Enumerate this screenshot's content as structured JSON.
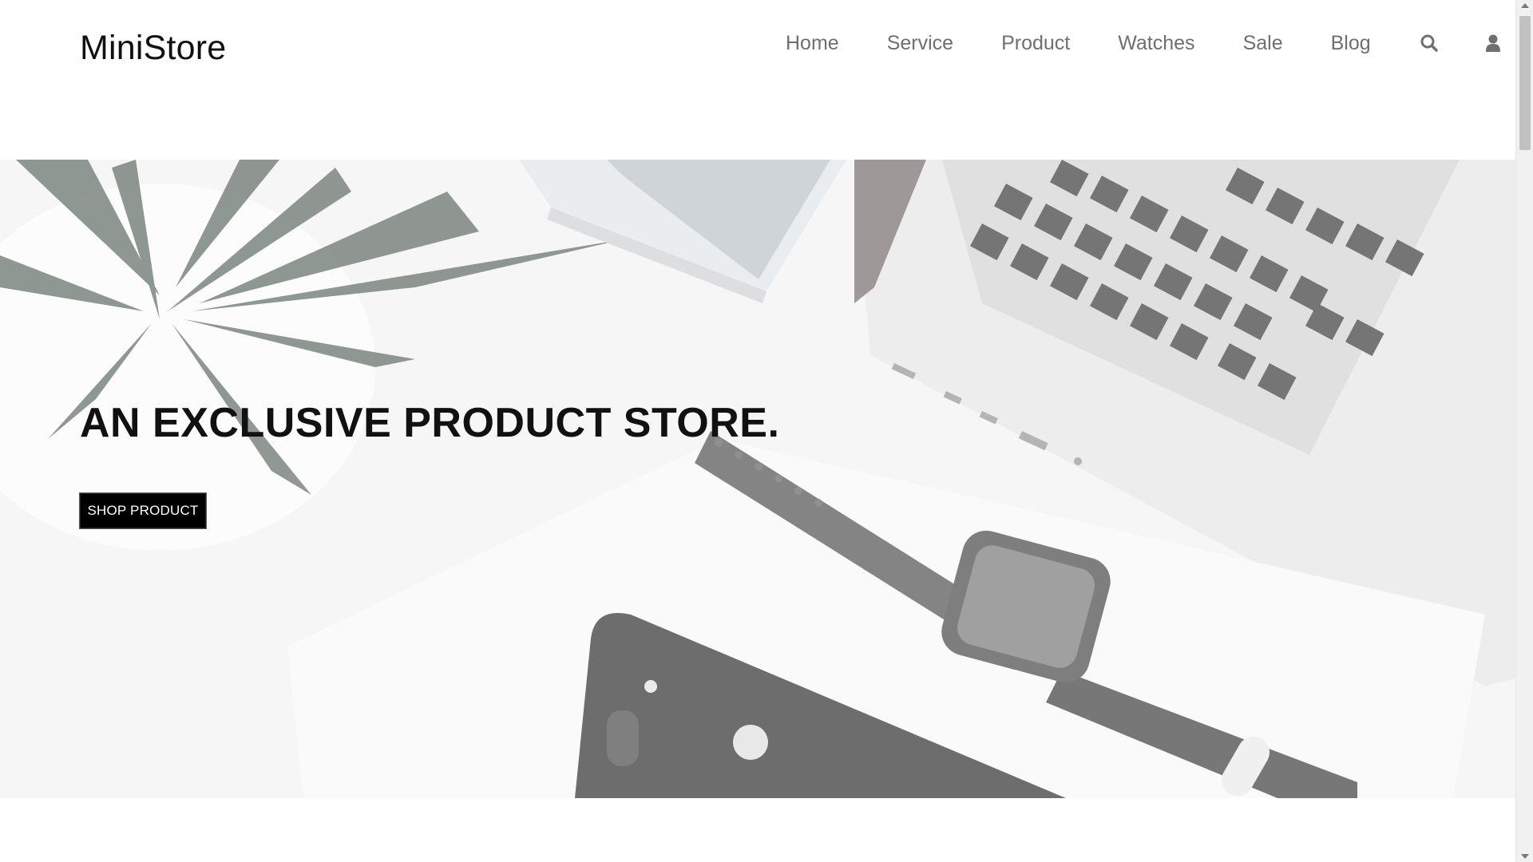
{
  "header": {
    "logo": "MiniStore",
    "nav": [
      {
        "label": "Home"
      },
      {
        "label": "Service"
      },
      {
        "label": "Product"
      },
      {
        "label": "Watches"
      },
      {
        "label": "Sale"
      },
      {
        "label": "Blog"
      }
    ],
    "icons": [
      "search-icon",
      "user-icon"
    ]
  },
  "hero": {
    "title": "AN EXCLUSIVE PRODUCT STORE.",
    "button_label": "SHOP PRODUCT"
  },
  "colors": {
    "nav_text": "#6f6f6f",
    "button_bg": "#000000",
    "button_text": "#ffffff"
  }
}
